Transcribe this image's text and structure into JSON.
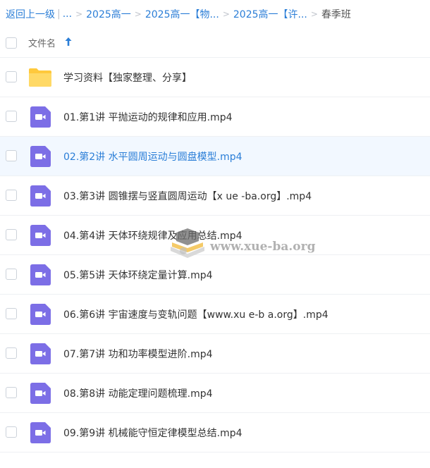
{
  "breadcrumb": {
    "back": "返回上一级",
    "divider": "|",
    "ellipsis": "...",
    "crumbs": [
      "2025高一",
      "2025高一【物...",
      "2025高一【许..."
    ],
    "current": "春季班"
  },
  "header": {
    "column_name": "文件名",
    "sort": "ascending"
  },
  "files": [
    {
      "name": "学习资料【独家整理、分享】",
      "type": "folder"
    },
    {
      "name": "01.第1讲 平抛运动的规律和应用.mp4",
      "type": "video"
    },
    {
      "name": "02.第2讲 水平圆周运动与圆盘模型.mp4",
      "type": "video",
      "selected": true
    },
    {
      "name": "03.第3讲 圆锥摆与竖直圆周运动【x ue -ba.org】.mp4",
      "type": "video"
    },
    {
      "name": "04.第4讲 天体环绕规律及应用总结.mp4",
      "type": "video"
    },
    {
      "name": "05.第5讲 天体环绕定量计算.mp4",
      "type": "video"
    },
    {
      "name": "06.第6讲 宇宙速度与变轨问题【www.xu e-b a.org】.mp4",
      "type": "video"
    },
    {
      "name": "07.第7讲 功和功率模型进阶.mp4",
      "type": "video"
    },
    {
      "name": "08.第8讲 动能定理问题梳理.mp4",
      "type": "video"
    },
    {
      "name": "09.第9讲 机械能守恒定律模型总结.mp4",
      "type": "video"
    }
  ],
  "watermark": {
    "text": "www.xue-ba.org"
  },
  "colors": {
    "link": "#2b7ed7",
    "folder": "#ffd34f",
    "video": "#7c6ee6",
    "selected_row": "#f2f8ff"
  }
}
